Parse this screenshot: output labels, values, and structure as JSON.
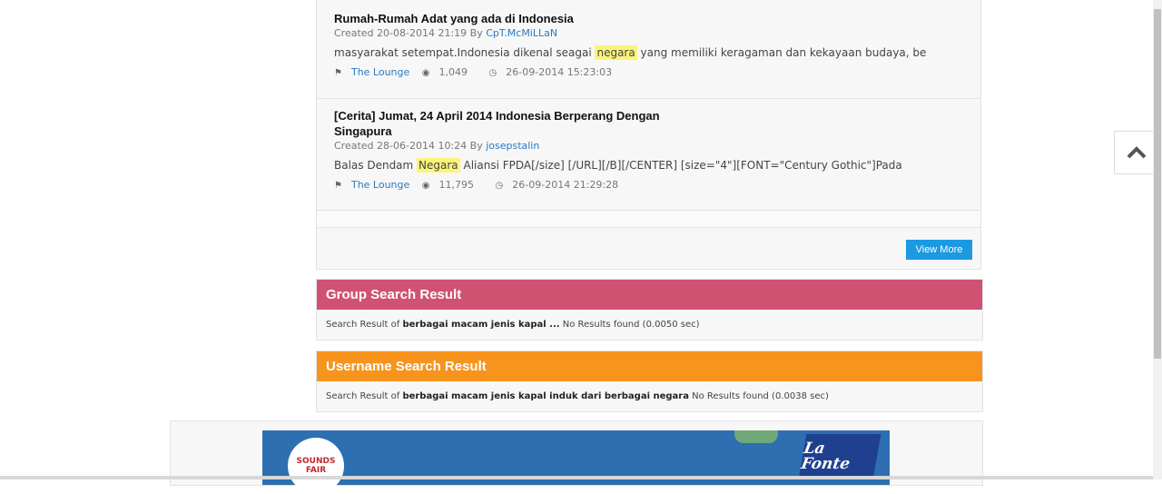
{
  "threads": [
    {
      "title": "Rumah-Rumah Adat yang ada di Indonesia",
      "created_prefix": "Created 20-08-2014 21:19 By ",
      "author": "CpT.McMiLLaN",
      "snippet_before": "masyarakat setempat.Indonesia dikenal seagai ",
      "snippet_highlight": "negara",
      "snippet_after": " yang memiliki keragaman dan kekayaan budaya, be",
      "forum": "The Lounge",
      "views": "1,049",
      "last_post": "26-09-2014 15:23:03"
    },
    {
      "title": "[Cerita] Jumat, 24 April 2014 Indonesia Berperang Dengan Singapura",
      "created_prefix": "Created 28-06-2014 10:24 By ",
      "author": "josepstalin",
      "snippet_before": "Balas Dendam ",
      "snippet_highlight": "Negara",
      "snippet_after": " Aliansi FPDA[/size] [/URL][/B][/CENTER] [size=\"4\"][FONT=\"Century Gothic\"]Pada",
      "forum": "The Lounge",
      "views": "11,795",
      "last_post": "26-09-2014 21:29:28"
    }
  ],
  "view_more_label": "View More",
  "group_result": {
    "header": "Group Search Result",
    "prefix": "Search Result of ",
    "query": "berbagai macam jenis kapal ...",
    "suffix": " No Results found (0.0050 sec)",
    "color": "#d05273"
  },
  "username_result": {
    "header": "Username Search Result",
    "prefix": "Search Result of ",
    "query": "berbagai macam jenis kapal induk dari berbagai negara",
    "suffix": " No Results found (0.0038 sec)",
    "color": "#f7941d"
  },
  "ad": {
    "left_logo_text": "SOUNDS FAIR",
    "right_logo_text": "La Fonte"
  },
  "icons": {
    "tag": "tag-icon",
    "views": "eye-icon",
    "clock": "clock-icon",
    "back_to_top": "chevron-up-icon"
  }
}
